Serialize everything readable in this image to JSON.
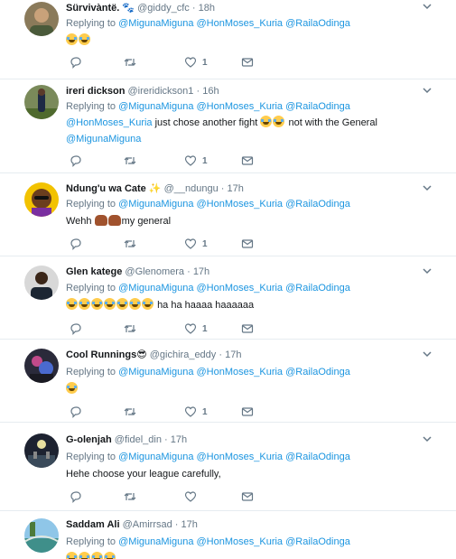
{
  "replying_label": "Replying to",
  "tweets": [
    {
      "name": "Sürvivàntë.",
      "extra": "🐾",
      "handle": "@giddy_cfc",
      "time": "18h",
      "mentions": [
        "@MigunaMiguna",
        "@HonMoses_Kuria",
        "@RailaOdinga"
      ],
      "text_parts": [
        {
          "emoji": "laugh",
          "count": 2
        }
      ],
      "likes": "1",
      "avatar_color": "#8a7a5a"
    },
    {
      "name": "ireri dickson",
      "handle": "@ireridickson1",
      "time": "16h",
      "mentions": [
        "@MigunaMiguna",
        "@HonMoses_Kuria",
        "@RailaOdinga"
      ],
      "line2_mention": "@HonMoses_Kuria",
      "line2_text": " just chose another fight ",
      "line2_text_b": " not with the General",
      "line3_mention": "@MigunaMiguna",
      "likes": "1",
      "avatar_color": "#5d6b3e"
    },
    {
      "name": "Ndung'u wa Cate",
      "extra": "✨",
      "handle": "@__ndungu",
      "time": "17h",
      "mentions": [
        "@MigunaMiguna",
        "@HonMoses_Kuria",
        "@RailaOdinga"
      ],
      "text_prefix": "Wehh ",
      "text_suffix": "my general",
      "likes": "1",
      "avatar_color": "#f2c200"
    },
    {
      "name": "Glen katege",
      "handle": "@Glenomera",
      "time": "17h",
      "mentions": [
        "@MigunaMiguna",
        "@HonMoses_Kuria",
        "@RailaOdinga"
      ],
      "text_suffix": "ha ha haaaa haaaaaa",
      "likes": "1",
      "avatar_color": "#2b3440"
    },
    {
      "name": "Cool Runnings",
      "extra": "😎",
      "handle": "@gichira_eddy",
      "time": "17h",
      "mentions": [
        "@MigunaMiguna",
        "@HonMoses_Kuria",
        "@RailaOdinga"
      ],
      "likes": "1",
      "avatar_color": "#3a3550"
    },
    {
      "name": "G-olenjah",
      "handle": "@fidel_din",
      "time": "17h",
      "mentions": [
        "@MigunaMiguna",
        "@HonMoses_Kuria",
        "@RailaOdinga"
      ],
      "text": "Hehe choose your league carefully,",
      "likes": "",
      "avatar_color": "#1d2230"
    },
    {
      "name": "Saddam Ali",
      "handle": "@Amirrsad",
      "time": "17h",
      "mentions": [
        "@MigunaMiguna",
        "@HonMoses_Kuria",
        "@RailaOdinga"
      ],
      "likes": "",
      "avatar_color": "#3f8f8a"
    }
  ]
}
